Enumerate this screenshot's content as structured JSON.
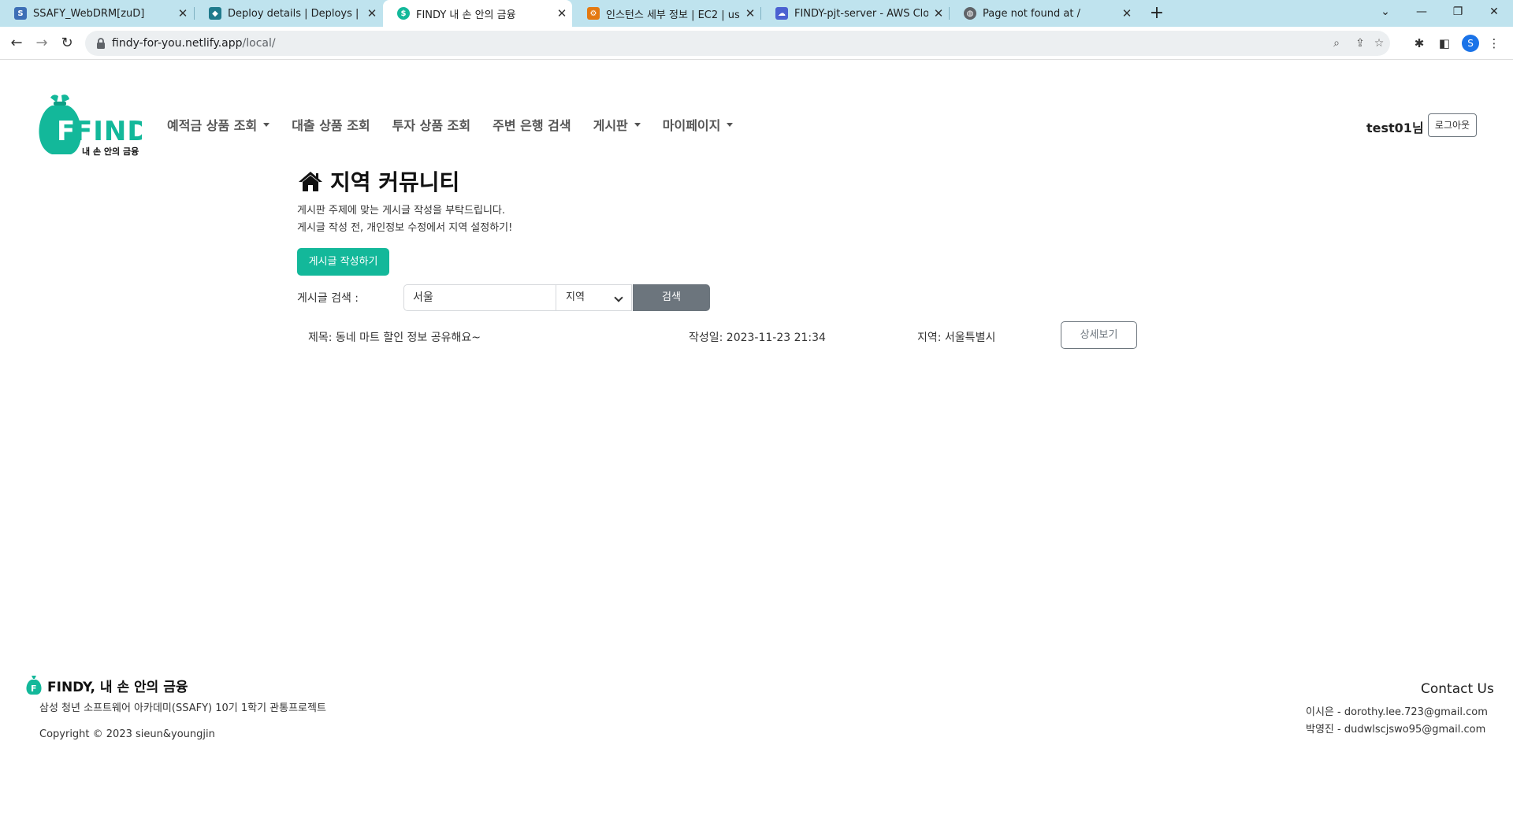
{
  "browser": {
    "tabs": [
      {
        "title": "SSAFY_WebDRM[zuD]",
        "favicon_color": "#3d6fb6"
      },
      {
        "title": "Deploy details | Deploys | findy",
        "favicon_color": "#1f7a8c"
      },
      {
        "title": "FINDY 내 손 안의 금융",
        "favicon_color": "#13b89a",
        "active": true
      },
      {
        "title": "인스턴스 세부 정보 | EC2 | us-e",
        "favicon_color": "#e47911"
      },
      {
        "title": "FINDY-pjt-server - AWS Cloud9",
        "favicon_color": "#4b61d1"
      },
      {
        "title": "Page not found at /",
        "favicon_color": "#5f6368"
      }
    ],
    "url_host": "findy-for-you.netlify.app",
    "url_path": "/local/",
    "profile_initial": "S"
  },
  "header": {
    "logo_text": "FINDY",
    "logo_sub": "내 손 안의 금융",
    "menu": [
      {
        "label": "예적금 상품 조회",
        "dropdown": true
      },
      {
        "label": "대출 상품 조회",
        "dropdown": false
      },
      {
        "label": "투자 상품 조회",
        "dropdown": false
      },
      {
        "label": "주변 은행 검색",
        "dropdown": false
      },
      {
        "label": "게시판",
        "dropdown": true
      },
      {
        "label": "마이페이지",
        "dropdown": true
      }
    ],
    "user": "test01님",
    "logout_label": "로그아웃"
  },
  "main": {
    "title": "지역 커뮤니티",
    "desc1": "게시판 주제에 맞는 게시글 작성을 부탁드립니다.",
    "desc2": "게시글 작성 전, 개인정보 수정에서 지역 설정하기!",
    "write_label": "게시글 작성하기",
    "search_label": "게시글 검색 :",
    "search_value": "서울",
    "select_value": "지역",
    "search_button": "검색",
    "posts": [
      {
        "title": "제목: 동네 마트 할인 정보 공유해요~",
        "date": "작성일: 2023-11-23 21:34",
        "region": "지역: 서울특별시",
        "detail_label": "상세보기"
      }
    ]
  },
  "footer": {
    "brand": "FINDY, 내 손 안의 금융",
    "sub": "삼성 청년 소프트웨어 아카데미(SSAFY) 10기 1학기 관통프로젝트",
    "copyright": "Copyright © 2023 sieun&youngjin",
    "contact_title": "Contact Us",
    "contacts": [
      "이시은 - dorothy.lee.723@gmail.com",
      "박영진 - dudwlscjswo95@gmail.com"
    ]
  },
  "colors": {
    "brand": "#13b89a",
    "secondary": "#6c757d",
    "tabstrip": "#bfe3ee"
  }
}
